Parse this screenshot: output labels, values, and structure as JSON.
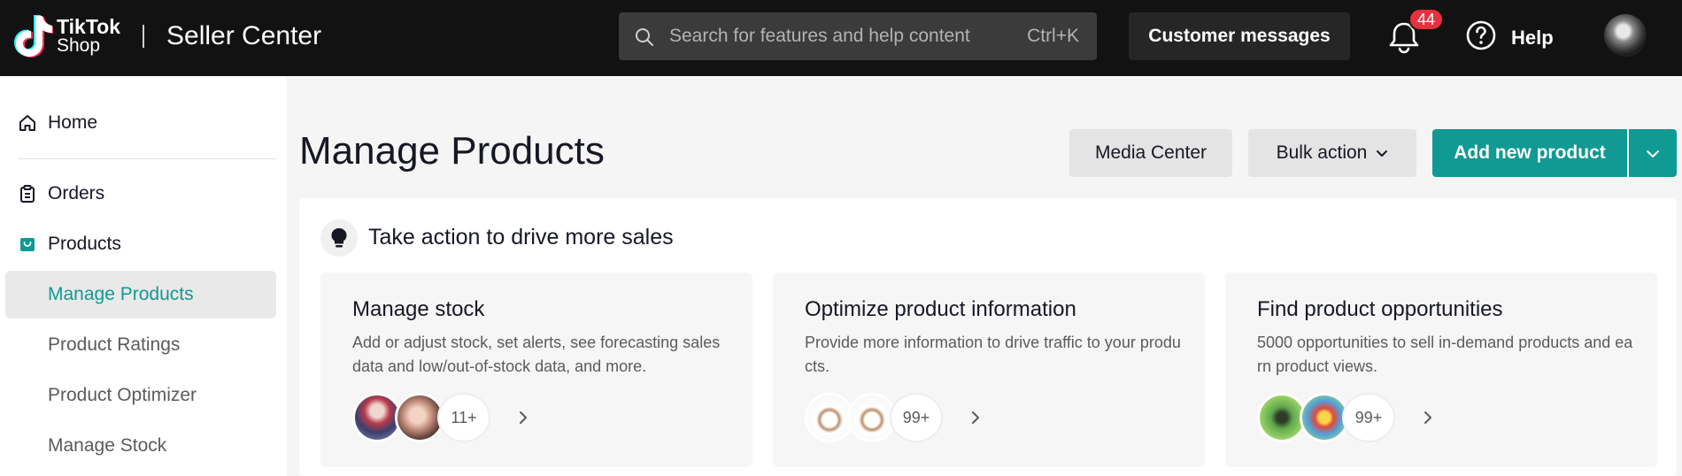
{
  "header": {
    "brand_line1": "TikTok",
    "brand_line2": "Shop",
    "brand_title": "Seller Center",
    "search": {
      "placeholder": "Search for features and help content",
      "shortcut": "Ctrl+K",
      "icon": "search-icon"
    },
    "customer_messages_label": "Customer messages",
    "notifications": {
      "icon": "bell-icon",
      "count": "44"
    },
    "help": {
      "icon": "help-circle-icon",
      "label": "Help"
    },
    "avatar_icon": "user-avatar"
  },
  "sidebar": {
    "items": [
      {
        "label": "Home",
        "icon": "home-icon"
      },
      {
        "label": "Orders",
        "icon": "clipboard-icon"
      },
      {
        "label": "Products",
        "icon": "shopping-bag-icon"
      }
    ],
    "sub_items": [
      {
        "label": "Manage Products",
        "active": true
      },
      {
        "label": "Product Ratings"
      },
      {
        "label": "Product Optimizer"
      },
      {
        "label": "Manage Stock"
      }
    ]
  },
  "main": {
    "title": "Manage Products",
    "media_center_label": "Media Center",
    "bulk_action_label": "Bulk action",
    "add_new_product_label": "Add new product",
    "panel": {
      "icon": "lightbulb-icon",
      "title": "Take action to drive more sales",
      "cards": [
        {
          "title": "Manage stock",
          "description": "Add or adjust stock, set alerts, see forecasting sales data and low/out-of-stock data, and more.",
          "count": "11+"
        },
        {
          "title": "Optimize product information",
          "description": "Provide more information to drive traffic to your products.",
          "count": "99+"
        },
        {
          "title": "Find product opportunities",
          "description": "5000 opportunities to sell in-demand products and earn product views.",
          "count": "99+"
        }
      ]
    }
  },
  "colors": {
    "brand_teal": "#0f9a93",
    "topbar_bg": "#121212",
    "badge_red": "#e8303e"
  }
}
